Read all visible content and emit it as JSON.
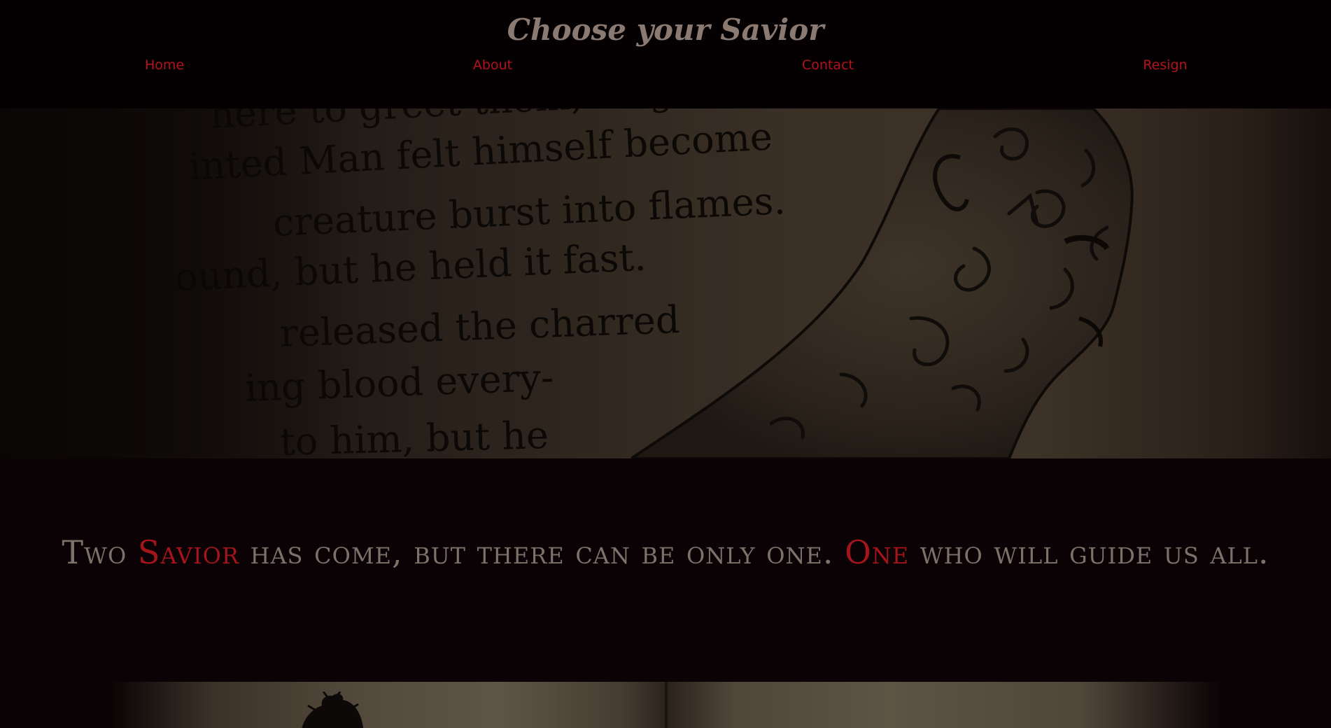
{
  "header": {
    "title": "Choose your Savior"
  },
  "nav": {
    "items": [
      {
        "label": "Home"
      },
      {
        "label": "About"
      },
      {
        "label": "Contact"
      },
      {
        "label": "Resign"
      }
    ]
  },
  "hero": {
    "image_text_lines": [
      "here to greet them, bright and",
      "inted Man felt himself become",
      "creature burst into flames.",
      "ound, but he held it fast.",
      "released the charred",
      "ing blood every-",
      "to him, but he"
    ]
  },
  "tagline": {
    "part1": "Two ",
    "accent1": "Savior",
    "part2": " has come, but there can be only one. ",
    "accent2": "One",
    "part3": " who will guide us all."
  },
  "colors": {
    "background": "#0a0204",
    "title": "#8a7a72",
    "accent": "#b1121c",
    "tagline": "#7d716a"
  }
}
